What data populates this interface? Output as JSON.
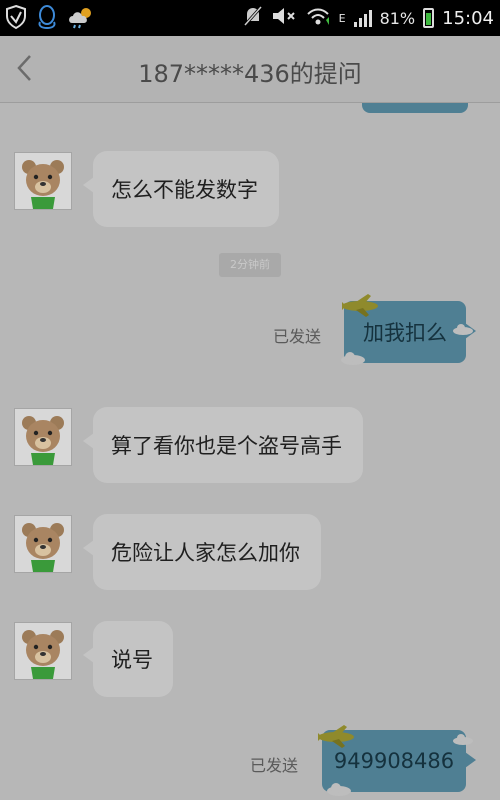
{
  "status_bar": {
    "battery": "81%",
    "time": "15:04",
    "network": "E"
  },
  "header": {
    "title": "187*****436的提问"
  },
  "chat": {
    "timestamp": "2分钟前",
    "messages": [
      {
        "side": "in",
        "text": "怎么不能发数字"
      },
      {
        "side": "out",
        "text": "加我扣么",
        "status": "已发送"
      },
      {
        "side": "in",
        "text": "算了看你也是个盗号高手"
      },
      {
        "side": "in",
        "text": "危险让人家怎么加你"
      },
      {
        "side": "in",
        "text": "说号"
      },
      {
        "side": "out",
        "text": "949908486",
        "status": "已发送"
      }
    ]
  }
}
